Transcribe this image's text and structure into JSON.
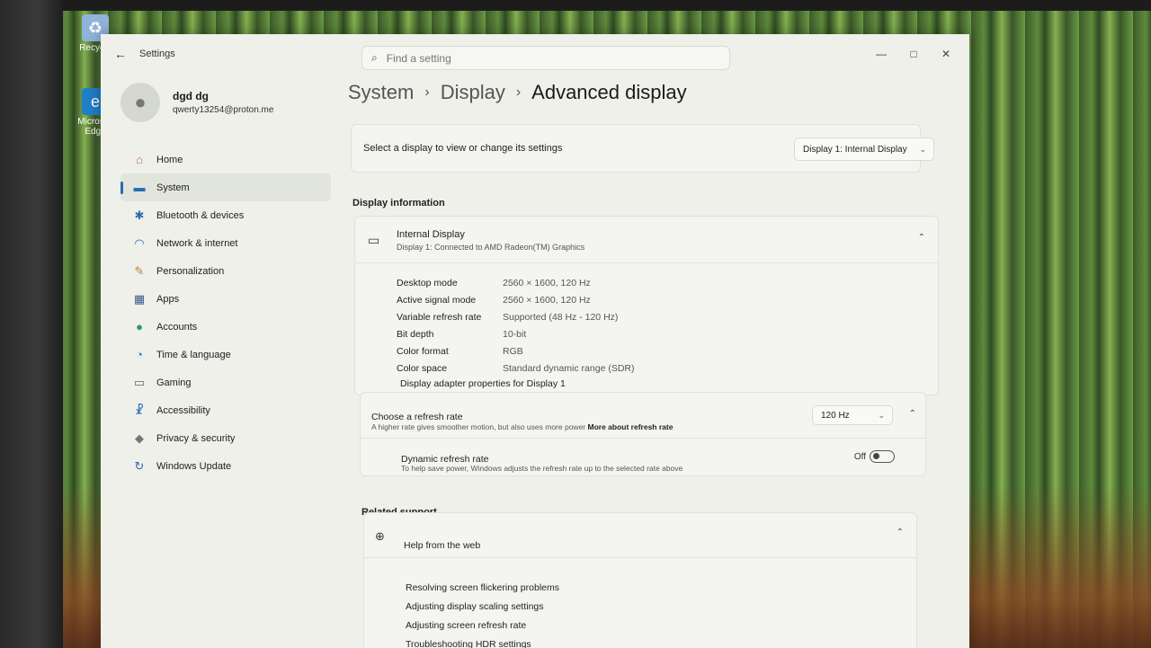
{
  "desktop": {
    "icons": [
      {
        "label": "Recycle",
        "icon": "recycle-bin-icon"
      },
      {
        "label": "Micros… Edge",
        "icon": "edge-icon"
      }
    ]
  },
  "window": {
    "title": "Settings",
    "search_placeholder": "Find a setting",
    "controls": {
      "minimize": "—",
      "maximize": "□",
      "close": "✕"
    }
  },
  "profile": {
    "name": "dgd dg",
    "email": "qwerty13254@proton.me"
  },
  "sidebar": {
    "items": [
      {
        "label": "Home",
        "icon": "home-icon",
        "glyph": "⌂",
        "color": "#c86a3a"
      },
      {
        "label": "System",
        "icon": "monitor-icon",
        "glyph": "▬",
        "color": "#2a6bb0"
      },
      {
        "label": "Bluetooth & devices",
        "icon": "bluetooth-icon",
        "glyph": "✱",
        "color": "#2a6bb0"
      },
      {
        "label": "Network & internet",
        "icon": "wifi-icon",
        "glyph": "◠",
        "color": "#2a6bb0"
      },
      {
        "label": "Personalization",
        "icon": "brush-icon",
        "glyph": "✎",
        "color": "#c07a3a"
      },
      {
        "label": "Apps",
        "icon": "apps-icon",
        "glyph": "▦",
        "color": "#3a5c88"
      },
      {
        "label": "Accounts",
        "icon": "accounts-icon",
        "glyph": "●",
        "color": "#2a9a6a"
      },
      {
        "label": "Time & language",
        "icon": "globe-clock-icon",
        "glyph": "◔",
        "color": "#2a7ab0"
      },
      {
        "label": "Gaming",
        "icon": "gamepad-icon",
        "glyph": "▭",
        "color": "#666666"
      },
      {
        "label": "Accessibility",
        "icon": "accessibility-icon",
        "glyph": "☧",
        "color": "#2a6bb0"
      },
      {
        "label": "Privacy & security",
        "icon": "shield-icon",
        "glyph": "◆",
        "color": "#777777"
      },
      {
        "label": "Windows Update",
        "icon": "update-icon",
        "glyph": "↻",
        "color": "#2a6bb0"
      }
    ],
    "active_index": 1
  },
  "breadcrumb": {
    "items": [
      "System",
      "Display",
      "Advanced display"
    ],
    "separator": "›"
  },
  "select_display": {
    "label": "Select a display to view or change its settings",
    "value": "Display 1: Internal Display"
  },
  "display_info": {
    "section_title": "Display information",
    "display_name": "Internal Display",
    "display_sub": "Display 1: Connected to AMD Radeon(TM) Graphics",
    "rows": [
      {
        "key": "Desktop mode",
        "value": "2560 × 1600, 120 Hz"
      },
      {
        "key": "Active signal mode",
        "value": "2560 × 1600, 120 Hz"
      },
      {
        "key": "Variable refresh rate",
        "value": "Supported (48 Hz - 120 Hz)"
      },
      {
        "key": "Bit depth",
        "value": "10-bit"
      },
      {
        "key": "Color format",
        "value": "RGB"
      },
      {
        "key": "Color space",
        "value": "Standard dynamic range (SDR)"
      }
    ],
    "adapter_link": "Display adapter properties for Display 1"
  },
  "refresh_rate": {
    "title": "Choose a refresh rate",
    "description": "A higher rate gives smoother motion, but also uses more power",
    "more_link": "More about refresh rate",
    "value": "120 Hz",
    "dynamic_title": "Dynamic refresh rate",
    "dynamic_description": "To help save power, Windows adjusts the refresh rate up to the selected rate above",
    "dynamic_state": "Off"
  },
  "related_support": {
    "section_title": "Related support",
    "help_title": "Help from the web",
    "links": [
      "Resolving screen flickering problems",
      "Adjusting display scaling settings",
      "Adjusting screen refresh rate",
      "Troubleshooting HDR settings"
    ]
  },
  "colors": {
    "accent": "#2a6bb0",
    "window_bg": "#eef0e9",
    "card_bg": "#f4f5f1"
  }
}
